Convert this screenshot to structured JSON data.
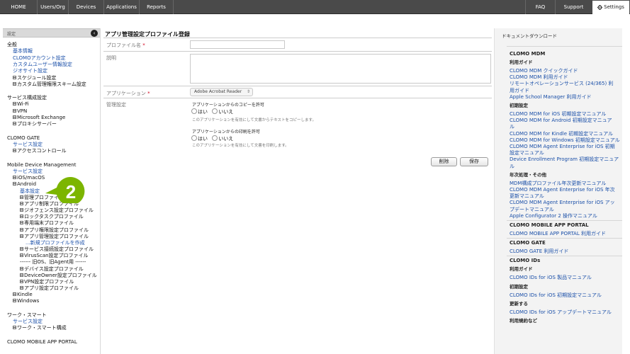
{
  "topnav": {
    "left": [
      "HOME",
      "Users/Org",
      "Devices",
      "Applications",
      "Reports"
    ],
    "right": [
      "FAQ",
      "Support"
    ],
    "settings": "Settings"
  },
  "sidebar": {
    "header": "設定",
    "lines": [
      {
        "text": "全般",
        "type": "head",
        "indent": 0
      },
      {
        "text": "基本情報",
        "type": "link",
        "indent": 1
      },
      {
        "text": "CLOMOアカウント設定",
        "type": "link",
        "indent": 1
      },
      {
        "text": "カスタムユーザー情報設定",
        "type": "link",
        "indent": 1
      },
      {
        "text": "ジオサイト設定",
        "type": "link",
        "indent": 1
      },
      {
        "text": "スケジュール設定",
        "type": "tree",
        "indent": 1
      },
      {
        "text": "カスタム管理権限スキーム設定",
        "type": "tree",
        "indent": 1
      },
      {
        "text": "サービス構成設定",
        "type": "head",
        "indent": 0,
        "gap": true
      },
      {
        "text": "Wi-Fi",
        "type": "tree",
        "indent": 1
      },
      {
        "text": "VPN",
        "type": "tree",
        "indent": 1
      },
      {
        "text": "Microsoft Exchange",
        "type": "tree",
        "indent": 1
      },
      {
        "text": "プロキシサーバー",
        "type": "tree",
        "indent": 1
      },
      {
        "text": "CLOMO GATE",
        "type": "head",
        "indent": 0,
        "gap": true
      },
      {
        "text": "サービス設定",
        "type": "link",
        "indent": 1
      },
      {
        "text": "アクセスコントロール",
        "type": "tree",
        "indent": 1
      },
      {
        "text": "Mobile Device Management",
        "type": "head",
        "indent": 0,
        "gap": true
      },
      {
        "text": "サービス設定",
        "type": "link",
        "indent": 1
      },
      {
        "text": "iOS/macOS",
        "type": "tree",
        "indent": 1
      },
      {
        "text": "Android",
        "type": "tree",
        "indent": 1
      },
      {
        "text": "基本設定",
        "type": "link",
        "indent": 2
      },
      {
        "text": "管理プロファイル",
        "type": "tree",
        "indent": 2
      },
      {
        "text": "アプリ制限プロファイル",
        "type": "tree",
        "indent": 2
      },
      {
        "text": "ジオフェンス設定プロファイル",
        "type": "tree",
        "indent": 2
      },
      {
        "text": "ロックタスクプロファイル",
        "type": "tree",
        "indent": 2
      },
      {
        "text": "専用端末プロファイル",
        "type": "tree",
        "indent": 2
      },
      {
        "text": "アプリ権限設定プロファイル",
        "type": "tree",
        "indent": 2
      },
      {
        "text": "アプリ管理設定プロファイル",
        "type": "tree",
        "indent": 2
      },
      {
        "text": "...新規プロファイルを作成",
        "type": "link",
        "indent": 3
      },
      {
        "text": "サービス接続設定プロファイル",
        "type": "tree",
        "indent": 2
      },
      {
        "text": "VirusScan設定プロファイル",
        "type": "tree",
        "indent": 2
      },
      {
        "text": "------ 旧OS、旧Agent用 ------",
        "type": "plain",
        "indent": 2
      },
      {
        "text": "デバイス設定プロファイル",
        "type": "tree",
        "indent": 2
      },
      {
        "text": "DeviceOwner設定プロファイル",
        "type": "tree",
        "indent": 2
      },
      {
        "text": "VPN設定プロファイル",
        "type": "tree",
        "indent": 2
      },
      {
        "text": "アプリ設定プロファイル",
        "type": "tree",
        "indent": 2
      },
      {
        "text": "Kindle",
        "type": "tree",
        "indent": 1
      },
      {
        "text": "Windows",
        "type": "tree",
        "indent": 1
      },
      {
        "text": "ワーク・スマート",
        "type": "head",
        "indent": 0,
        "gap": true
      },
      {
        "text": "サービス設定",
        "type": "link",
        "indent": 1
      },
      {
        "text": "ワーク・スマート構成",
        "type": "tree",
        "indent": 1
      },
      {
        "text": "CLOMO MOBILE APP PORTAL",
        "type": "head",
        "indent": 0,
        "gap": true
      }
    ],
    "badge_number": "2",
    "badge_color": "#7cb500"
  },
  "main": {
    "title": "アプリ管理設定プロファイル登録",
    "profile_name_label": "プロファイル名",
    "required_mark": "*",
    "profile_name_value": "",
    "description_label": "説明",
    "description_value": "",
    "application_label": "アプリケーション",
    "application_value": "Adobe Acrobat Reader",
    "management_label": "管理設定",
    "copy_title": "アプリケーションからのコピーを許可",
    "yes": "はい",
    "no": "いいえ",
    "copy_hint": "このアプリケーションを有効にして文書からテキストをコピーします。",
    "print_title": "アプリケーションからの印刷を許可",
    "print_hint": "このアプリケーションを有効にして文書を印刷します。",
    "delete_button": "削除",
    "save_button": "保存"
  },
  "docs": {
    "title": "ドキュメントダウンロード",
    "lines": [
      {
        "text": "CLOMO MDM",
        "type": "h1"
      },
      {
        "text": "利用ガイド",
        "type": "h2"
      },
      {
        "text": "CLOMO MDM クイックガイド",
        "type": "link"
      },
      {
        "text": "CLOMO MDM 利用ガイド",
        "type": "link"
      },
      {
        "text": "リモートオペレーションサービス (24/365) 利",
        "type": "link"
      },
      {
        "text": "用ガイド",
        "type": "link"
      },
      {
        "text": "Apple School Manager 利用ガイド",
        "type": "link"
      },
      {
        "text": "初期設定",
        "type": "h2"
      },
      {
        "text": "CLOMO MDM for iOS 初期設定マニュアル",
        "type": "link"
      },
      {
        "text": "CLOMO MDM for Android 初期設定マニュア",
        "type": "link"
      },
      {
        "text": "ル",
        "type": "link"
      },
      {
        "text": "CLOMO MDM for Kindle 初期設定マニュアル",
        "type": "link"
      },
      {
        "text": "CLOMO MDM for Windows 初期設定マニュアル",
        "type": "link"
      },
      {
        "text": "CLOMO MDM Agent Enterprise for iOS 初期",
        "type": "link"
      },
      {
        "text": "設定マニュアル",
        "type": "link"
      },
      {
        "text": "Device Enrollment Program 初期設定マニュア",
        "type": "link"
      },
      {
        "text": "ル",
        "type": "link"
      },
      {
        "text": "年次処理・その他",
        "type": "h2"
      },
      {
        "text": "MDM構成プロファイル年次更新マニュアル",
        "type": "link"
      },
      {
        "text": "CLOMO MDM Agent Enterprise for iOS 年次",
        "type": "link"
      },
      {
        "text": "更新マニュアル",
        "type": "link"
      },
      {
        "text": "CLOMO MDM Agent Enterprise for iOS アッ",
        "type": "link"
      },
      {
        "text": "プデートマニュアル",
        "type": "link"
      },
      {
        "text": "Apple Configurator 2 操作マニュアル",
        "type": "link"
      },
      {
        "text": "CLOMO MOBILE APP PORTAL",
        "type": "h1"
      },
      {
        "text": "CLOMO MOBILE APP PORTAL 利用ガイド",
        "type": "link"
      },
      {
        "text": "CLOMO GATE",
        "type": "h1"
      },
      {
        "text": "CLOMO GATE 利用ガイド",
        "type": "link"
      },
      {
        "text": "CLOMO IDs",
        "type": "h1"
      },
      {
        "text": "利用ガイド",
        "type": "h2"
      },
      {
        "text": "CLOMO IDs for iOS 製品マニュアル",
        "type": "link"
      },
      {
        "text": "初期設定",
        "type": "h2"
      },
      {
        "text": "CLOMO IDs for iOS 初期設定マニュアル",
        "type": "link"
      },
      {
        "text": "更新する",
        "type": "h2"
      },
      {
        "text": "CLOMO IDs for iOS アップデートマニュアル",
        "type": "link"
      },
      {
        "text": "利用規約など",
        "type": "h2"
      }
    ]
  }
}
